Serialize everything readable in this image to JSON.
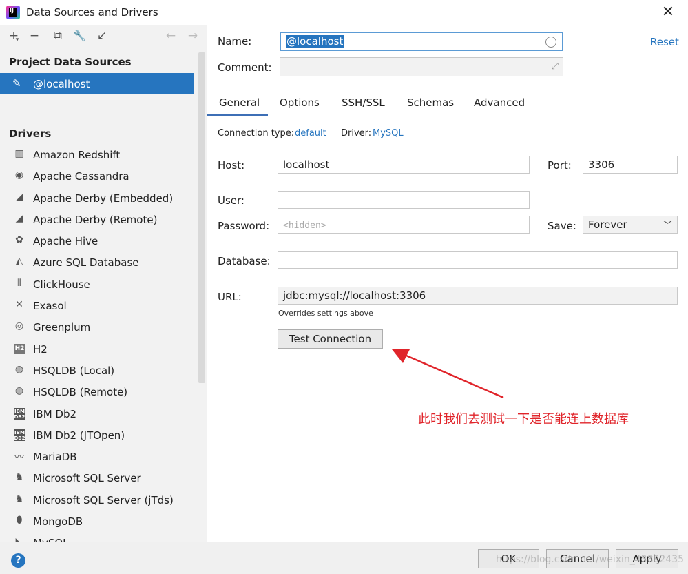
{
  "window": {
    "title": "Data Sources and Drivers",
    "close_symbol": "✕"
  },
  "sidebar": {
    "toolbar": {
      "add": "+",
      "add_arrow": "▾",
      "remove": "−",
      "duplicate": "⧉",
      "settings": "🔧",
      "import": "↙",
      "back": "←",
      "forward": "→"
    },
    "project_title": "Project Data Sources",
    "data_sources": [
      {
        "label": "@localhost",
        "icon": "mysql-icon"
      }
    ],
    "drivers_title": "Drivers",
    "drivers": [
      {
        "label": "Amazon Redshift",
        "icon": "redshift-icon",
        "glyph": "▥"
      },
      {
        "label": "Apache Cassandra",
        "icon": "cassandra-icon",
        "glyph": "◉"
      },
      {
        "label": "Apache Derby (Embedded)",
        "icon": "derby-icon",
        "glyph": "◢"
      },
      {
        "label": "Apache Derby (Remote)",
        "icon": "derby-icon",
        "glyph": "◢"
      },
      {
        "label": "Apache Hive",
        "icon": "hive-icon",
        "glyph": "✿"
      },
      {
        "label": "Azure SQL Database",
        "icon": "azure-icon",
        "glyph": "◭"
      },
      {
        "label": "ClickHouse",
        "icon": "clickhouse-icon",
        "glyph": "⦀"
      },
      {
        "label": "Exasol",
        "icon": "exasol-icon",
        "glyph": "✕"
      },
      {
        "label": "Greenplum",
        "icon": "greenplum-icon",
        "glyph": "◎"
      },
      {
        "label": "H2",
        "icon": "h2-icon",
        "glyph": "H2"
      },
      {
        "label": "HSQLDB (Local)",
        "icon": "hsqldb-icon",
        "glyph": "◍"
      },
      {
        "label": "HSQLDB (Remote)",
        "icon": "hsqldb-icon",
        "glyph": "◍"
      },
      {
        "label": "IBM Db2",
        "icon": "db2-icon",
        "glyph": "IBM DB2"
      },
      {
        "label": "IBM Db2 (JTOpen)",
        "icon": "db2-icon",
        "glyph": "IBM DB2"
      },
      {
        "label": "MariaDB",
        "icon": "mariadb-icon",
        "glyph": "〰"
      },
      {
        "label": "Microsoft SQL Server",
        "icon": "sqlserver-icon",
        "glyph": "♞"
      },
      {
        "label": "Microsoft SQL Server (jTds)",
        "icon": "sqlserver-icon",
        "glyph": "♞"
      },
      {
        "label": "MongoDB",
        "icon": "mongodb-icon",
        "glyph": "⬮"
      },
      {
        "label": "MySQL",
        "icon": "mysql-icon",
        "glyph": "◣"
      }
    ]
  },
  "main": {
    "name_label": "Name:",
    "name_value": "@localhost",
    "comment_label": "Comment:",
    "reset": "Reset",
    "tabs": [
      {
        "label": "General"
      },
      {
        "label": "Options"
      },
      {
        "label": "SSH/SSL"
      },
      {
        "label": "Schemas"
      },
      {
        "label": "Advanced"
      }
    ],
    "connection_type_label": "Connection type:",
    "connection_type_value": "default",
    "driver_label": "Driver:",
    "driver_value": "MySQL",
    "host_label": "Host:",
    "host_value": "localhost",
    "port_label": "Port:",
    "port_value": "3306",
    "user_label": "User:",
    "user_value": "",
    "password_label": "Password:",
    "password_placeholder": "<hidden>",
    "save_label": "Save:",
    "save_value": "Forever",
    "database_label": "Database:",
    "database_value": "",
    "url_label": "URL:",
    "url_value": "jdbc:mysql://localhost:3306",
    "url_hint": "Overrides settings above",
    "test_connection": "Test Connection",
    "annotation": "此时我们去测试一下是否能连上数据库"
  },
  "footer": {
    "help": "?",
    "ok": "OK",
    "cancel": "Cancel",
    "apply": "Apply",
    "watermark": "https://blog.csdn.net/weixin_43882435"
  },
  "colors": {
    "selection": "#2675bf",
    "annotation": "#e0242a",
    "link": "#2675bf"
  }
}
